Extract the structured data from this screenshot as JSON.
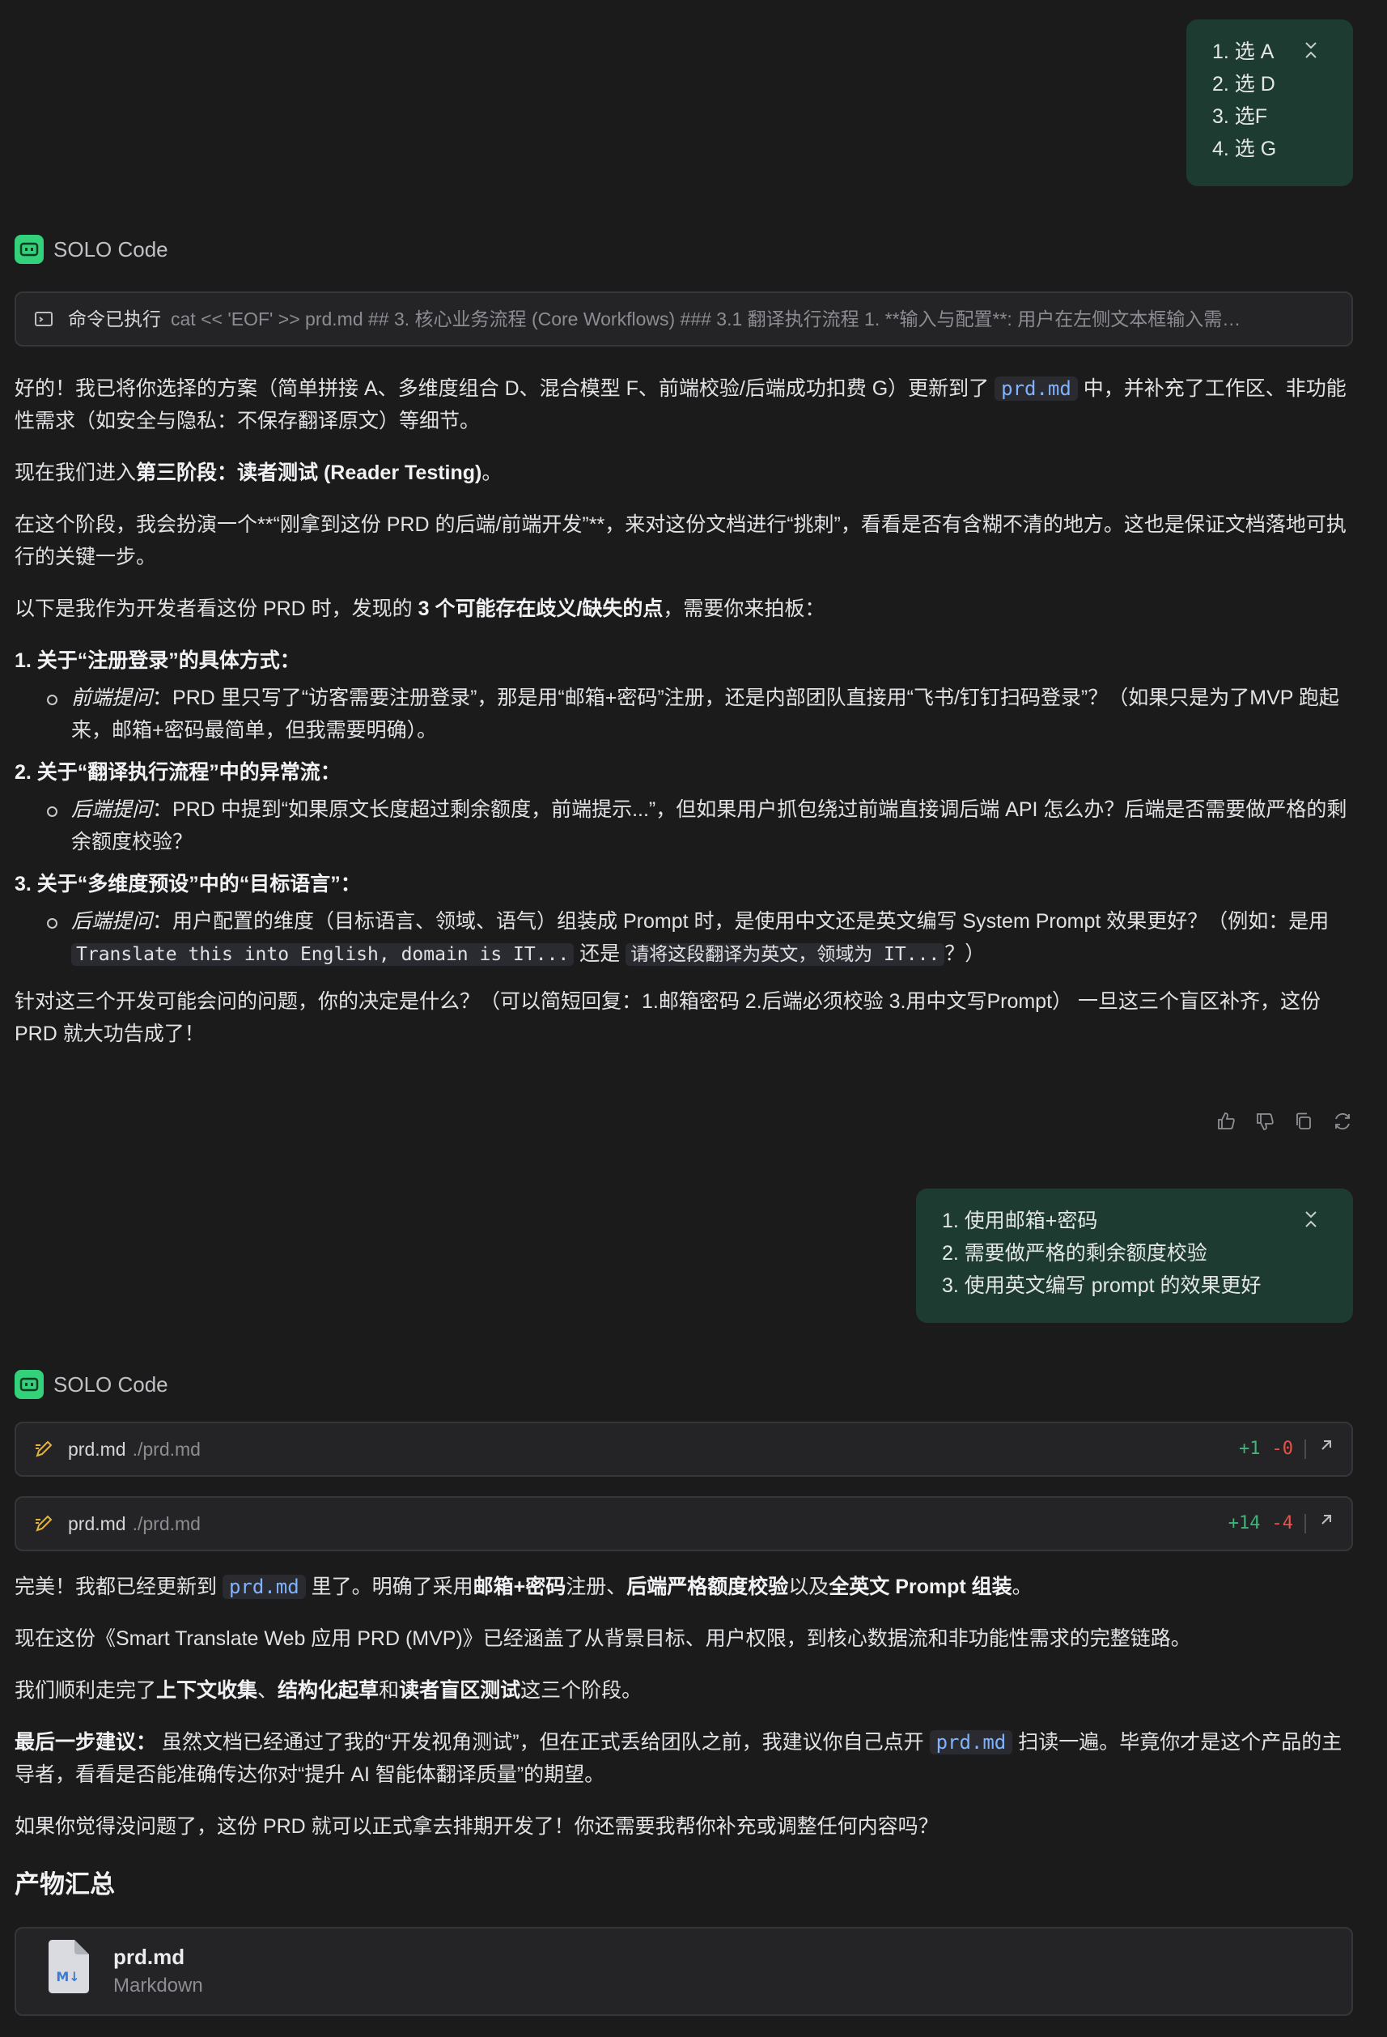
{
  "msg1": {
    "items": [
      "1. 选 A",
      "2. 选 D",
      "3. 选F",
      "4. 选 G"
    ]
  },
  "agent_label": "SOLO Code",
  "command": {
    "label": "命令已执行",
    "text": "cat << 'EOF' >> prd.md ## 3. 核心业务流程 (Core Workflows) ### 3.1 翻译执行流程 1. **输入与配置**: 用户在左侧文本框输入需…"
  },
  "reply1": {
    "p1_a": "好的！我已将你选择的方案（简单拼接 A、多维度组合 D、混合模型 F、前端校验/后端成功扣费 G）更新到了 ",
    "p1_code": "prd.md",
    "p1_b": " 中，并补充了工作区、非功能性需求（如安全与隐私：不保存翻译原文）等细节。",
    "p2_a": "现在我们进入",
    "p2_b": "第三阶段：读者测试 (Reader Testing)",
    "p2_c": "。",
    "p3": "在这个阶段，我会扮演一个**“刚拿到这份 PRD 的后端/前端开发”**，来对这份文档进行“挑刺”，看看是否有含糊不清的地方。这也是保证文档落地可执行的关键一步。",
    "p4_a": "以下是我作为开发者看这份 PRD 时，发现的 ",
    "p4_b": "3 个可能存在歧义/缺失的点",
    "p4_c": "，需要你来拍板：",
    "q1_title": "1. 关于“注册登录”的具体方式：",
    "q1_label": "前端提问",
    "q1_text": "：PRD 里只写了“访客需要注册登录”，那是用“邮箱+密码”注册，还是内部团队直接用“飞书/钉钉扫码登录”？（如果只是为了MVP 跑起来，邮箱+密码最简单，但我需要明确）。",
    "q2_title": "2. 关于“翻译执行流程”中的异常流：",
    "q2_label": "后端提问",
    "q2_text": "：PRD 中提到“如果原文长度超过剩余额度，前端提示...”，但如果用户抓包绕过前端直接调后端 API 怎么办？后端是否需要做严格的剩余额度校验？",
    "q3_title": "3. 关于“多维度预设”中的“目标语言”：",
    "q3_label": "后端提问",
    "q3_text_a": "：用户配置的维度（目标语言、领域、语气）组装成 Prompt 时，是使用中文还是英文编写 System Prompt 效果更好？（例如：是用 ",
    "q3_code1": "Translate this into English, domain is IT...",
    "q3_text_b": " 还是 ",
    "q3_code2": "请将这段翻译为英文，领域为 IT...",
    "q3_text_c": "？）",
    "p5": "针对这三个开发可能会问的问题，你的决定是什么？（可以简短回复：1.邮箱密码 2.后端必须校验 3.用中文写Prompt） 一旦这三个盲区补齐，这份 PRD 就大功告成了！"
  },
  "msg2": {
    "items": [
      "1. 使用邮箱+密码",
      "2. 需要做严格的剩余额度校验",
      "3. 使用英文编写 prompt 的效果更好"
    ]
  },
  "edits": [
    {
      "file": "prd.md",
      "path": "./prd.md",
      "add": "+1",
      "del": "-0"
    },
    {
      "file": "prd.md",
      "path": "./prd.md",
      "add": "+14",
      "del": "-4"
    }
  ],
  "reply2": {
    "p1_a": "完美！我都已经更新到 ",
    "p1_code": "prd.md",
    "p1_b": " 里了。明确了采用",
    "p1_c": "邮箱+密码",
    "p1_d": "注册、",
    "p1_e": "后端严格额度校验",
    "p1_f": "以及",
    "p1_g": "全英文 Prompt 组装",
    "p1_h": "。",
    "p2": "现在这份《Smart Translate Web 应用 PRD (MVP)》已经涵盖了从背景目标、用户权限，到核心数据流和非功能性需求的完整链路。",
    "p3_a": "我们顺利走完了",
    "p3_b": "上下文收集",
    "p3_c": "、",
    "p3_d": "结构化起草",
    "p3_e": "和",
    "p3_f": "读者盲区测试",
    "p3_g": "这三个阶段。",
    "p4_a": "最后一步建议：",
    "p4_b": " 虽然文档已经通过了我的“开发视角测试”，但在正式丢给团队之前，我建议你自己点开 ",
    "p4_code": "prd.md",
    "p4_c": " 扫读一遍。毕竟你才是这个产品的主导者，看看是否能准确传达你对“提升 AI 智能体翻译质量”的期望。",
    "p5": "如果你觉得没问题了，这份 PRD 就可以正式拿去排期开发了！你还需要我帮你补充或调整任何内容吗？"
  },
  "artifacts_title": "产物汇总",
  "artifact": {
    "name": "prd.md",
    "type": "Markdown",
    "badge": "M↓"
  },
  "colors": {
    "bg": "#1b1b1c",
    "user_bubble": "#1d3b30",
    "accent": "#33d17a",
    "code_blue": "#7fb2ff",
    "diff_add": "#3fb57a",
    "diff_del": "#e5534b"
  }
}
